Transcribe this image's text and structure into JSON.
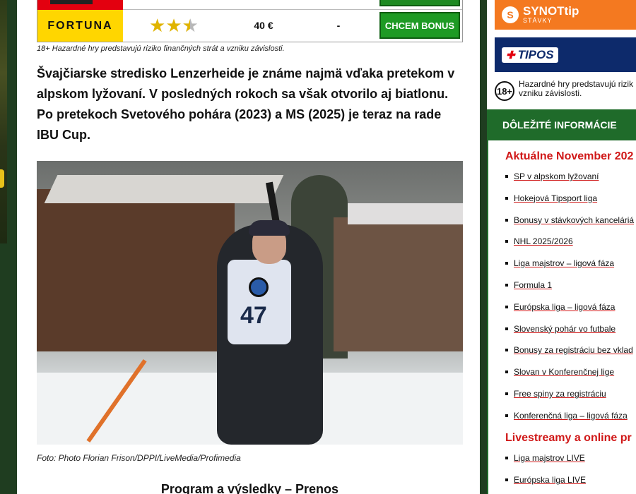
{
  "bookmaker": {
    "name": "FORTUNA",
    "rating": 2.5,
    "amount": "40 €",
    "extra": "-",
    "button": "CHCEM BONUS"
  },
  "disclaimer": "18+ Hazardné hry predstavujú riziko finančných strát a vzniku závislosti.",
  "intro": "Švajčiarske stredisko Lenzerheide je známe najmä vďaka pretekom v alpskom lyžovaní. V posledných rokoch sa však otvorilo aj biatlonu. Po pretekoch Svetového pohára (2023) a MS (2025) je teraz na rade IBU Cup.",
  "photo": {
    "bib_number": "47"
  },
  "caption": "Foto: Photo Florian Frison/DPPI/LiveMedia/Profimedia",
  "section_heading": "Program a výsledky – Prenos",
  "sidebar": {
    "synot_brand": "SYNOTtip",
    "synot_sub": "STÁVKY",
    "tipos_brand": "TIPOS",
    "age_badge": "18+",
    "age_text": "Hazardné hry predstavujú rizik vzniku závislosti.",
    "info_header": "DÔLEŽITÉ INFORMÁCIE",
    "section1_title": "Aktuálne November 202",
    "section1_items": [
      "SP v alpskom lyžovaní",
      "Hokejová Tipsport liga",
      "Bonusy v stávkových kanceláriá",
      "NHL 2025/2026",
      "Liga majstrov – ligová fáza",
      "Formula 1",
      "Európska liga – ligová fáza",
      "Slovenský pohár vo futbale",
      "Bonusy za registráciu bez vklad",
      "Slovan v Konferenčnej lige",
      "Free spiny za registráciu",
      "Konferenčná liga – ligová fáza"
    ],
    "section2_title": "Livestreamy a online pr",
    "section2_items": [
      "Liga majstrov LIVE",
      "Európska liga LIVE"
    ]
  }
}
